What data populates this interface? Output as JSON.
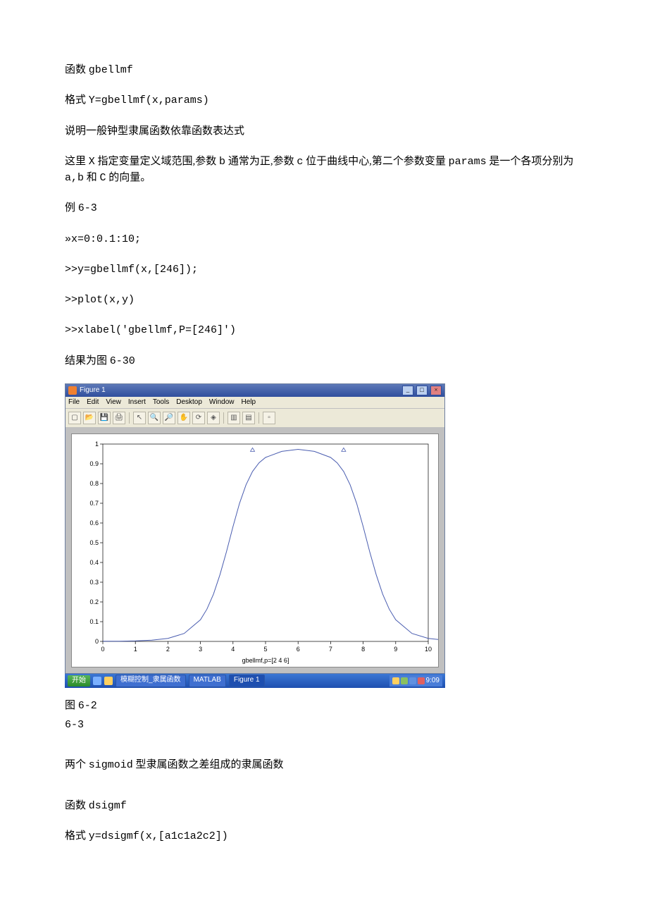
{
  "text": {
    "p1a": "函数",
    "p1b": "gbellmf",
    "p2a": "格式",
    "p2b": "Y=gbellmf(x,params)",
    "p3": "说明一般钟型隶属函数依靠函数表达式",
    "p4a": "这里",
    "p4b": "X",
    "p4c": "指定变量定义域范围,参数",
    "p4d": "b",
    "p4e": "通常为正,参数",
    "p4f": "c",
    "p4g": "位于曲线中心,第二个参数变量",
    "p4h": "params",
    "p4i": "是一个各项分别为",
    "p4j": "a,b",
    "p4k": "和",
    "p4l": "C",
    "p4m": "的向量。",
    "p5a": "例",
    "p5b": "6-3",
    "p6": "»x=0:0.1:10;",
    "p7": ">>y=gbellmf(x,[246]);",
    "p8": ">>plot(x,y)",
    "p9": ">>xlabel('gbellmf,P=[246]')",
    "p10a": "结果为图",
    "p10b": "6-30",
    "p11a": "图",
    "p11b": "6-2",
    "p12": "6-3",
    "p13a": "两个",
    "p13b": "sigmoid",
    "p13c": "型隶属函数之差组成的隶属函数",
    "p14a": "函数",
    "p14b": "dsigmf",
    "p15a": "格式",
    "p15b": "y=dsigmf(x,[a1c1a2c2])"
  },
  "window": {
    "title": "Figure 1",
    "menu": [
      "File",
      "Edit",
      "View",
      "Insert",
      "Tools",
      "Desktop",
      "Window",
      "Help"
    ],
    "xlabel": "gbellmf,p=[2 4 6]"
  },
  "taskbar": {
    "start": "开始",
    "items": [
      "模糊控制_隶属函数",
      "MATLAB",
      "Figure 1"
    ],
    "clock": "9:09"
  },
  "chart_data": {
    "type": "line",
    "title": "",
    "xlabel": "gbellmf,p=[2 4 6]",
    "ylabel": "",
    "xlim": [
      0,
      10
    ],
    "ylim": [
      0,
      1
    ],
    "xticks": [
      0,
      1,
      2,
      3,
      4,
      5,
      6,
      7,
      8,
      9,
      10
    ],
    "yticks": [
      0,
      0.1,
      0.2,
      0.3,
      0.4,
      0.5,
      0.6,
      0.7,
      0.8,
      0.9,
      1
    ],
    "x": [
      0,
      0.5,
      1,
      1.5,
      2,
      2.5,
      3,
      3.2,
      3.4,
      3.6,
      3.8,
      4,
      4.2,
      4.4,
      4.6,
      4.8,
      5,
      5.5,
      6,
      6.5,
      7,
      7.2,
      7.4,
      7.6,
      7.8,
      8,
      8.2,
      8.4,
      8.6,
      8.8,
      9,
      9.5,
      10,
      10.5
    ],
    "values": [
      0.0006,
      0.0012,
      0.0026,
      0.0062,
      0.0154,
      0.0402,
      0.1098,
      0.1637,
      0.2397,
      0.3381,
      0.4555,
      0.5819,
      0.6989,
      0.7935,
      0.861,
      0.9051,
      0.932,
      0.963,
      0.9732,
      0.963,
      0.932,
      0.9051,
      0.861,
      0.7935,
      0.6989,
      0.5819,
      0.4555,
      0.3381,
      0.2397,
      0.1637,
      0.1098,
      0.0402,
      0.0154,
      0.0062
    ]
  }
}
